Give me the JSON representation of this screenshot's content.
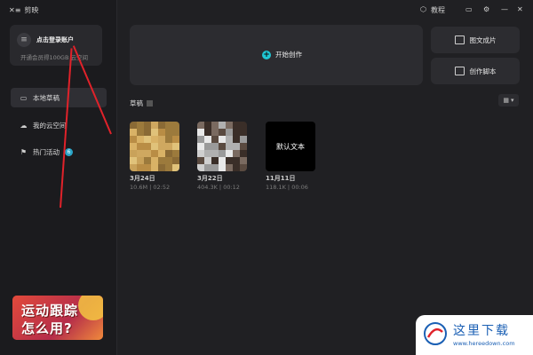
{
  "app": {
    "brand_icon": "capcut-logo-icon",
    "brand_name": "剪映"
  },
  "topbar": {
    "tutorial_label": "教程",
    "icons": [
      "tutorial-icon",
      "feedback-icon",
      "settings-icon"
    ],
    "window_controls": [
      "—",
      "✕"
    ]
  },
  "account": {
    "login_label": "点击登录账户",
    "subtitle": "开通会员得100GB 云空间"
  },
  "sidebar": {
    "items": [
      {
        "label": "本地草稿",
        "icon": "folder-icon",
        "active": true
      },
      {
        "label": "我的云空间",
        "icon": "cloud-icon",
        "active": false
      },
      {
        "label": "热门活动",
        "icon": "flag-icon",
        "active": false,
        "badge": "6"
      }
    ]
  },
  "banner": {
    "line1": "运动跟踪",
    "line2": "怎么用?"
  },
  "main": {
    "start_label": "开始创作",
    "side_cards": [
      {
        "label": "图文成片"
      },
      {
        "label": "创作脚本"
      }
    ],
    "drafts_title": "草稿",
    "drafts": [
      {
        "date": "3月24日",
        "meta": "10.6M | 02:52"
      },
      {
        "date": "3月22日",
        "meta": "404.3K | 00:12"
      },
      {
        "date": "11月11日",
        "meta": "118.1K | 00:06",
        "text": "默认文本"
      }
    ]
  },
  "watermark": {
    "text": "这里下载",
    "url": "www.hereedown.com"
  },
  "colors": {
    "accent": "#1fc7d4",
    "background": "#202023",
    "sidebar": "#1b1b1e",
    "arrow": "#e0222a"
  }
}
